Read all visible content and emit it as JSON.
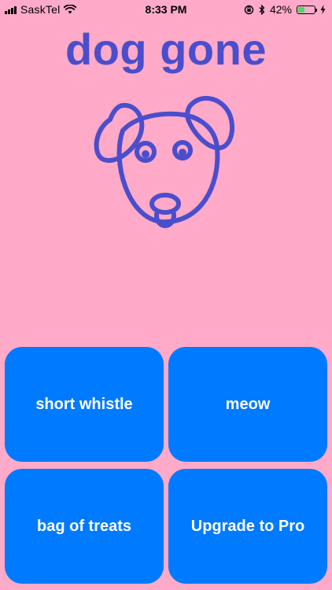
{
  "status_bar": {
    "carrier": "SaskTel",
    "time": "8:33 PM",
    "battery_percent": "42%",
    "battery_level": 0.42,
    "icons": [
      "signal-icon",
      "wifi-icon",
      "lock-rotation-icon",
      "bluetooth-icon",
      "battery-icon",
      "charging-icon"
    ]
  },
  "app": {
    "title": "dog gone",
    "title_color": "#4a4ecc",
    "background": "#ffaac8",
    "illustration": "dog-face-icon"
  },
  "buttons": {
    "color": "#007aff",
    "short_whistle": "short whistle",
    "meow": "meow",
    "bag_of_treats": "bag of treats",
    "upgrade": "Upgrade to Pro"
  }
}
